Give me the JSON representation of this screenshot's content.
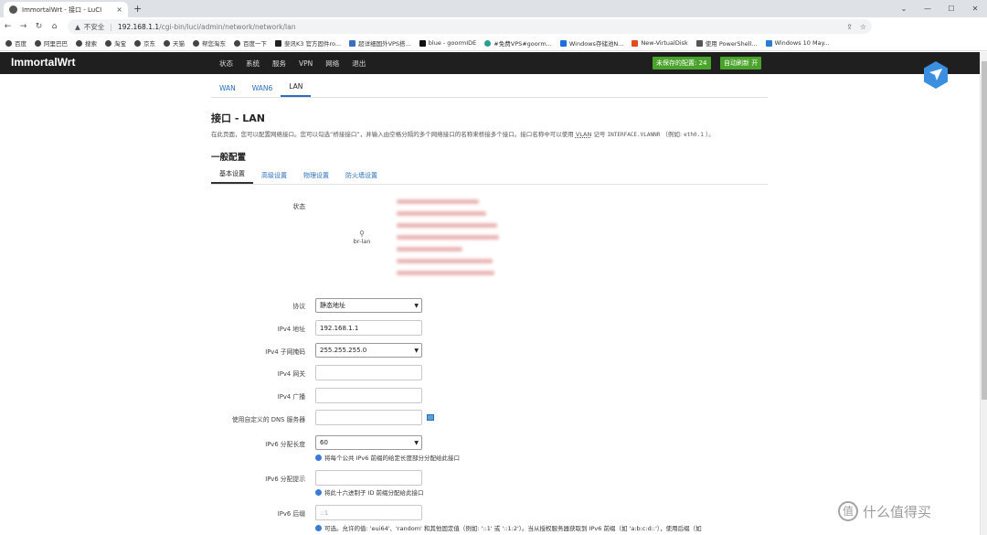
{
  "browser": {
    "tab_title": "ImmortalWrt - 接口 - LuCI",
    "tab_close": "×",
    "new_tab": "+",
    "window_controls": [
      "⌄",
      "—",
      "☐",
      "✕"
    ],
    "nav": {
      "back": "←",
      "forward": "→",
      "reload": "↻",
      "home": "⌂"
    },
    "insecure_label": "不安全",
    "url_host": "192.168.1.1",
    "url_path": "/cgi-bin/luci/admin/network/network/lan",
    "bookmarks": [
      "百度",
      "阿里巴巴",
      "搜索",
      "淘宝",
      "京东",
      "天猫",
      "帮您淘东",
      "百度一下",
      "斐讯K3 官方固件ro...",
      "超详细国外VPS搭...",
      "blue - goormIDE",
      "#免费VPS#goorm...",
      "Windows存储池N...",
      "New-VirtualDisk",
      "使用 PowerShell...",
      "Windows 10 May..."
    ]
  },
  "header": {
    "brand": "ImmortalWrt",
    "menu": [
      "状态",
      "系统",
      "服务",
      "VPN",
      "网络",
      "退出"
    ],
    "unsaved_label": "未保存的配置: 24",
    "auto_refresh_label": "自动刷新 开"
  },
  "iface_tabs": [
    "WAN",
    "WAN6",
    "LAN"
  ],
  "page": {
    "title": "接口 - LAN",
    "description_1": "在此页面，您可以配置网络接口。您可以勾选“桥接接口”，并输入由空格分隔的多个网络接口的名称来桥接多个接口。接口名称中可以使用",
    "description_vlan": "VLAN",
    "description_2": "记号",
    "description_code": "INTERFACE.VLANNR",
    "description_3": "（例如:",
    "description_code2": "eth0.1",
    "description_4": "）。",
    "section_title": "一般配置"
  },
  "sub_tabs": [
    "基本设置",
    "高级设置",
    "物理设置",
    "防火墙设置"
  ],
  "form": {
    "status_label": "状态",
    "br_lan": "br-lan",
    "protocol_label": "协议",
    "protocol_value": "静态地址",
    "ipv4_addr_label": "IPv4 地址",
    "ipv4_addr_value": "192.168.1.1",
    "ipv4_mask_label": "IPv4 子网掩码",
    "ipv4_mask_value": "255.255.255.0",
    "ipv4_gw_label": "IPv4 网关",
    "ipv4_bcast_label": "IPv4 广播",
    "dns_label": "使用自定义的 DNS 服务器",
    "ipv6_assign_len_label": "IPv6 分配长度",
    "ipv6_assign_len_value": "60",
    "ipv6_assign_len_hint": "将每个公共 IPv6 前缀的给定长度部分分配给此接口",
    "ipv6_assign_hint_label": "IPv6 分配提示",
    "ipv6_assign_hint_hint": "将此十六进制子 ID 前缀分配给此接口",
    "ipv6_suffix_label": "IPv6 后缀",
    "ipv6_suffix_placeholder": "::1",
    "ipv6_suffix_hint": "可选。允许的值: 'eui64'、'random' 和其他固定值（例如: '::1' 或 '::1:2'）。当从授权服务器获取到 IPv6 前缀（如 'a:b:c:d::'），使用后缀（如"
  },
  "watermark": "什么值得买",
  "watermark_logo": "值",
  "colors": {
    "header_bg": "#1f1f1f",
    "accent": "#2a6fbd",
    "button_green": "#4aa32b"
  }
}
